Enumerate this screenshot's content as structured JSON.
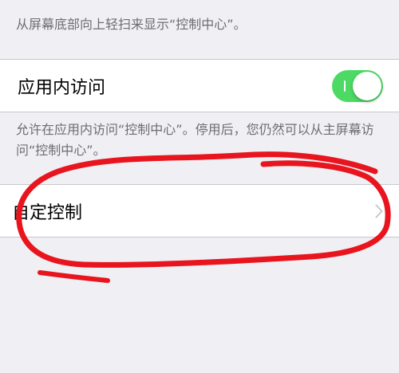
{
  "top_note": "从屏幕底部向上轻扫来显示“控制中心”。",
  "access_within_apps": {
    "label": "应用内访问",
    "state": "on"
  },
  "access_note": "允许在应用内访问“控制中心”。停用后，您仍然可以从主屏幕访问“控制中心”。",
  "customize_controls": {
    "label": "自定控制",
    "accessory_icon": "chevron-right-icon"
  },
  "colors": {
    "background": "#efeff4",
    "toggle_on": "#4cd964",
    "annotation": "#e8141e",
    "footer_text": "#6d6d72"
  }
}
